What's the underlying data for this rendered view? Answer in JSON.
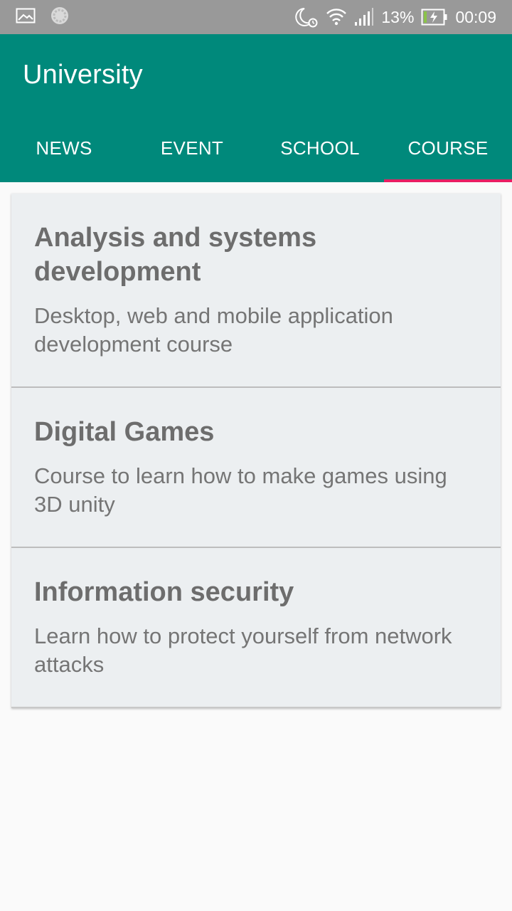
{
  "status_bar": {
    "left_icons": [
      "image-icon",
      "sync-icon"
    ],
    "right_icons": [
      "night-alarm-icon",
      "wifi-icon",
      "signal-icon"
    ],
    "battery_percent": "13%",
    "time": "00:09"
  },
  "app_bar": {
    "title": "University",
    "tabs": [
      {
        "label": "NEWS"
      },
      {
        "label": "EVENT"
      },
      {
        "label": "SCHOOL"
      },
      {
        "label": "COURSE"
      }
    ],
    "selected_tab": "COURSE",
    "colors": {
      "primary": "#00897b",
      "indicator": "#e91e63"
    }
  },
  "courses": [
    {
      "title": "Analysis and systems development",
      "description": "Desktop, web and mobile application development course"
    },
    {
      "title": "Digital Games",
      "description": "Course to learn how to make games using 3D unity"
    },
    {
      "title": "Information security",
      "description": "Learn how to protect yourself from network attacks"
    }
  ]
}
